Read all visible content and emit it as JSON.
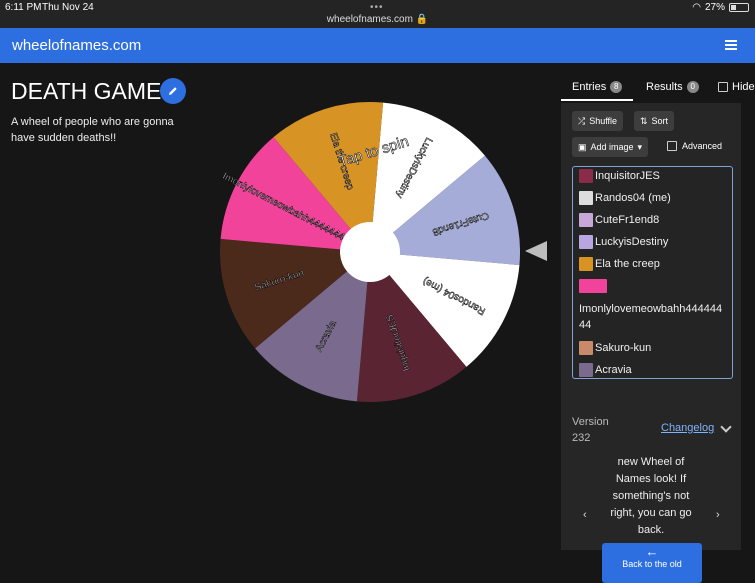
{
  "status_bar": {
    "time": "6:11 PM",
    "date": "Thu Nov 24",
    "url": "wheelofnames.com",
    "battery": "27%"
  },
  "appbar": {
    "brand": "wheelofnames.com"
  },
  "wheel_title": "DEATH GAME",
  "wheel_description": "A wheel of people who are gonna have sudden deaths!!",
  "wheel": {
    "tap_label": "Tap to spin",
    "slices": [
      {
        "label": "LuckyisDestiny",
        "color": "#ffffff"
      },
      {
        "label": "CuteFr1end8",
        "color": "#a6acd8"
      },
      {
        "label": "Randos04 (me)",
        "color": "#ffffff"
      },
      {
        "label": "InquisitorJES",
        "color": "#5a2433"
      },
      {
        "label": "Acravia",
        "color": "#7a6a8e"
      },
      {
        "label": "Sakuro-kun",
        "color": "#4b2a1c"
      },
      {
        "label": "Imonlylovemeowbahh44444444",
        "color": "#f2439a"
      },
      {
        "label": "Ela the creep",
        "color": "#d89325"
      }
    ]
  },
  "tabs": {
    "entries_label": "Entries",
    "entries_count": "8",
    "results_label": "Results",
    "results_count": "0",
    "hide_label": "Hide"
  },
  "toolbar": {
    "shuffle": "Shuffle",
    "sort": "Sort",
    "add_image": "Add image",
    "advanced": "Advanced"
  },
  "entries": [
    {
      "text": "InquisitorJES",
      "thumb": "#8a2b4a"
    },
    {
      "text": "Randos04 (me)",
      "thumb": "#ddd"
    },
    {
      "text": "CuteFr1end8",
      "thumb": "#c9a6d8"
    },
    {
      "text": "LuckyisDestiny",
      "thumb": "#b9a6e0"
    },
    {
      "text": "Ela the creep",
      "thumb": "#d89325"
    },
    {
      "text": "Imonlylovemeowbahh44444444",
      "thumb": "#f2439a"
    },
    {
      "text": "Sakuro-kun",
      "thumb": "#c88a6a"
    },
    {
      "text": "Acravia",
      "thumb": "#7a6a8e"
    }
  ],
  "version": {
    "label": "Version",
    "number": "232",
    "changelog": "Changelog"
  },
  "news": {
    "text": "new Wheel of Names look! If something's not right, you can go back.",
    "back_label": "Back to the old"
  }
}
